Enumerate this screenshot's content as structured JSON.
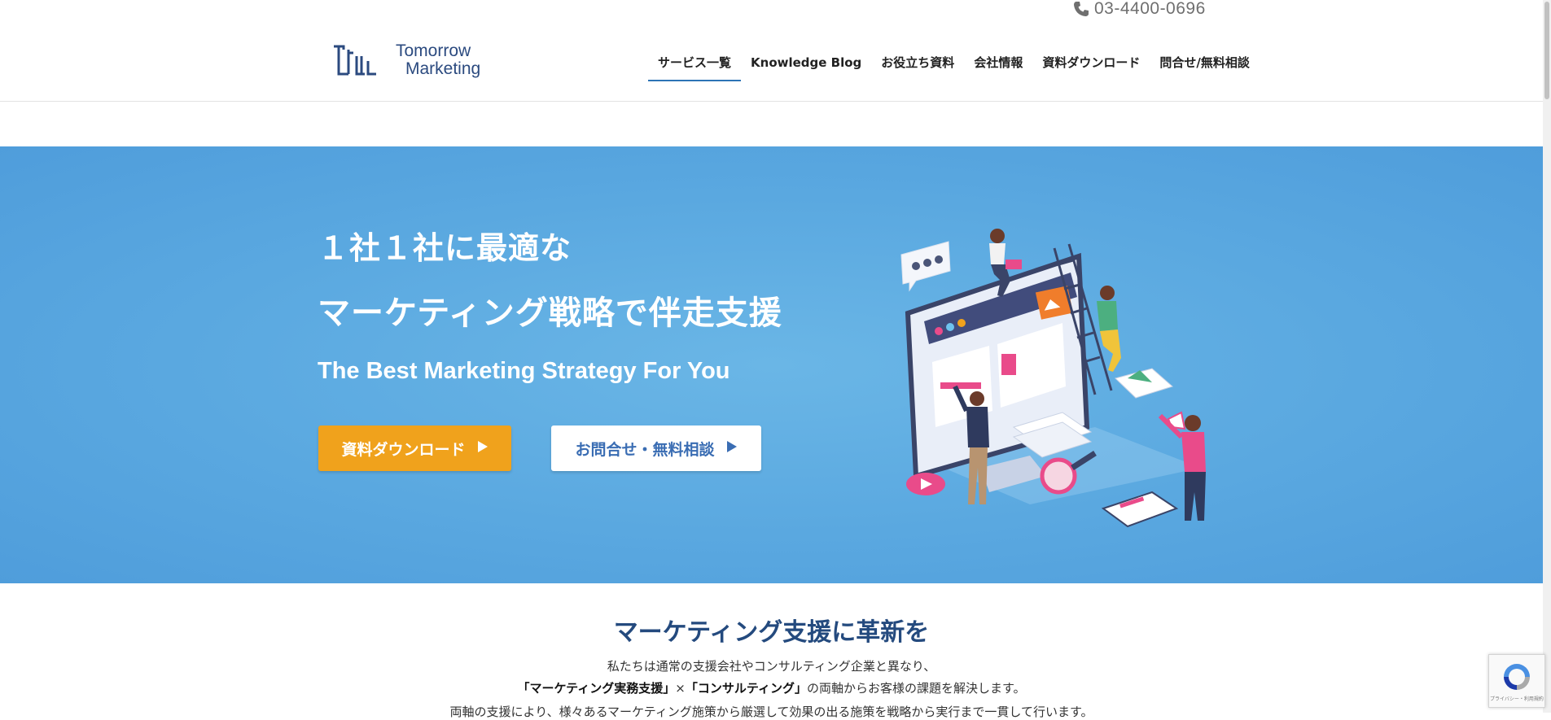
{
  "header": {
    "phone": "03-4400-0696",
    "logo_line1": "Tomorrow",
    "logo_line2": "Marketing",
    "nav": [
      {
        "label": "サービス一覧",
        "active": true
      },
      {
        "label": "Knowledge Blog"
      },
      {
        "label": "お役立ち資料"
      },
      {
        "label": "会社情報"
      },
      {
        "label": "資料ダウンロード"
      },
      {
        "label": "問合せ/無料相談"
      }
    ]
  },
  "hero": {
    "line1": "１社１社に最適な",
    "line2": "マーケティング戦略で伴走支援",
    "subtitle": "The Best Marketing Strategy For You",
    "btn_download": "資料ダウンロード",
    "btn_contact": "お問合せ・無料相談"
  },
  "intro": {
    "title": "マーケティング支援に革新を",
    "p1": "私たちは通常の支援会社やコンサルティング企業と異なり、",
    "p2_bold1": "「マーケティング実務支援」",
    "p2_mid": "×",
    "p2_bold2": "「コンサルティング」",
    "p2_rest": "の両軸からお客様の課題を解決します。",
    "p3": "両軸の支援により、様々あるマーケティング施策から厳選して効果の出る施策を戦略から実行まで一貫して行います。"
  },
  "recaptcha": {
    "text": "プライバシー・利用規約"
  },
  "colors": {
    "accent": "#2c74b6",
    "hero_bg": "#5aa8e0",
    "download_btn": "#f0a21c",
    "title": "#244a7e"
  }
}
